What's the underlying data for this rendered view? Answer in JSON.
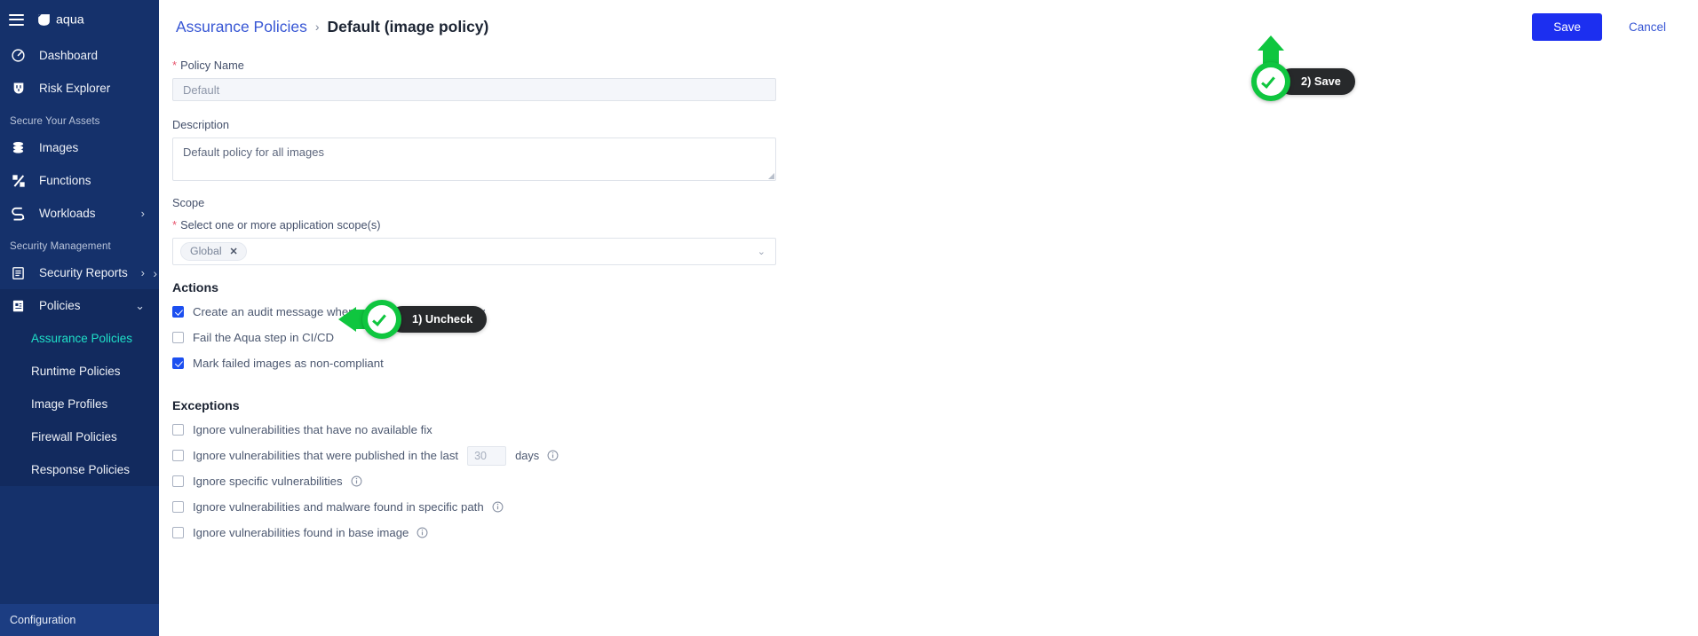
{
  "sidebar": {
    "brand": "aqua",
    "menu_icon": "hamburger-icon",
    "collapse_icon": "chevron-right-icon",
    "items": [
      {
        "label": "Dashboard",
        "icon": "dashboard-gauge-icon",
        "chevron": ""
      },
      {
        "label": "Risk Explorer",
        "icon": "shield-risk-icon",
        "chevron": ""
      }
    ],
    "section_assets": "Secure Your Assets",
    "asset_items": [
      {
        "label": "Images",
        "icon": "layers-stack-icon",
        "chevron": ""
      },
      {
        "label": "Functions",
        "icon": "function-lambda-icon",
        "chevron": ""
      },
      {
        "label": "Workloads",
        "icon": "workloads-icon",
        "chevron": "›"
      }
    ],
    "section_security": "Security Management",
    "security_items": [
      {
        "label": "Security Reports",
        "icon": "report-document-icon",
        "chevron": "›"
      },
      {
        "label": "Policies",
        "icon": "policies-icon",
        "chevron": "∨"
      }
    ],
    "policy_subitems": [
      {
        "label": "Assurance Policies",
        "active": true
      },
      {
        "label": "Runtime Policies",
        "active": false
      },
      {
        "label": "Image Profiles",
        "active": false
      },
      {
        "label": "Firewall Policies",
        "active": false
      },
      {
        "label": "Response Policies",
        "active": false
      }
    ],
    "footer": "Configuration",
    "colors": {
      "bg": "#15316b",
      "active_text": "#1fe0c8",
      "group_bg": "#122a5e",
      "footer_bg": "#1c3d82"
    }
  },
  "header": {
    "breadcrumb_parent": "Assurance Policies",
    "breadcrumb_separator": "›",
    "breadcrumb_current": "Default (image policy)",
    "save_label": "Save",
    "cancel_label": "Cancel",
    "save_color": "#1c2ff0",
    "link_color": "#3756d4"
  },
  "form": {
    "policy_name": {
      "label": "Policy Name",
      "required_mark": "*",
      "value": "Default",
      "placeholder": "Default",
      "disabled": true
    },
    "description": {
      "label": "Description",
      "value": "Default policy for all images",
      "placeholder": "Default policy for all images"
    },
    "scope": {
      "title": "Scope",
      "required_mark": "*",
      "label": "Select one or more application scope(s)",
      "tags": [
        {
          "label": "Global",
          "remove_icon": "close-icon"
        }
      ],
      "caret_icon": "chevron-down-icon"
    },
    "actions": {
      "title": "Actions",
      "items": [
        {
          "label": "Create an audit message when an image fails this policy",
          "checked": true
        },
        {
          "label": "Fail the Aqua step in CI/CD",
          "checked": false
        },
        {
          "label": "Mark failed images as non-compliant",
          "checked": true
        }
      ]
    },
    "exceptions": {
      "title": "Exceptions",
      "items": [
        {
          "label": "Ignore vulnerabilities that have no available fix",
          "checked": false,
          "info": false,
          "input": null,
          "unit": ""
        },
        {
          "label": "Ignore vulnerabilities that were published in the last",
          "checked": false,
          "info": true,
          "input": "30",
          "unit": "days"
        },
        {
          "label": "Ignore specific vulnerabilities",
          "checked": false,
          "info": true,
          "input": null,
          "unit": ""
        },
        {
          "label": "Ignore vulnerabilities and malware found in specific path",
          "checked": false,
          "info": true,
          "input": null,
          "unit": ""
        },
        {
          "label": "Ignore vulnerabilities found in base image",
          "checked": false,
          "info": true,
          "input": null,
          "unit": ""
        }
      ]
    }
  },
  "annotations": [
    {
      "label": "1) Uncheck",
      "icon": "green-check-badge",
      "pointer": "left-arrow",
      "color": "#0fc63f"
    },
    {
      "label": "2) Save",
      "icon": "green-check-badge",
      "pointer": "up-arrow",
      "color": "#0fc63f"
    }
  ]
}
